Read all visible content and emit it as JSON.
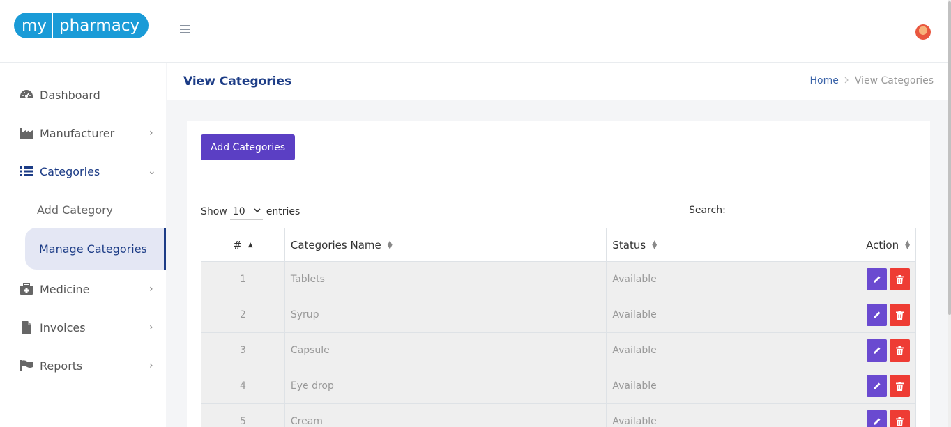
{
  "brand": {
    "my": "my",
    "pharmacy": "pharmacy"
  },
  "sidebar": {
    "items": [
      {
        "label": "Dashboard",
        "icon": "dashboard-icon",
        "chevron": ""
      },
      {
        "label": "Manufacturer",
        "icon": "factory-icon",
        "chevron": "›"
      },
      {
        "label": "Categories",
        "icon": "list-icon",
        "chevron": "⌄"
      },
      {
        "label": "Medicine",
        "icon": "medkit-icon",
        "chevron": "›"
      },
      {
        "label": "Invoices",
        "icon": "file-icon",
        "chevron": "›"
      },
      {
        "label": "Reports",
        "icon": "flag-icon",
        "chevron": "›"
      }
    ],
    "subitems": [
      {
        "label": "Add Category"
      },
      {
        "label": "Manage Categories"
      }
    ]
  },
  "page": {
    "title": "View Categories",
    "breadcrumb": {
      "home": "Home",
      "separator": ">",
      "current": "View Categories"
    }
  },
  "toolbar": {
    "add_label": "Add Categories"
  },
  "table_controls": {
    "show_label": "Show",
    "entries_value": "10",
    "entries_label": "entries",
    "search_label": "Search:",
    "search_value": ""
  },
  "table": {
    "columns": [
      "#",
      "Categories Name",
      "Status",
      "Action"
    ],
    "rows": [
      {
        "num": "1",
        "name": "Tablets",
        "status": "Available"
      },
      {
        "num": "2",
        "name": "Syrup",
        "status": "Available"
      },
      {
        "num": "3",
        "name": "Capsule",
        "status": "Available"
      },
      {
        "num": "4",
        "name": "Eye drop",
        "status": "Available"
      },
      {
        "num": "5",
        "name": "Cream",
        "status": "Available"
      }
    ]
  },
  "colors": {
    "brand": "#1a9bd7",
    "primary": "#5b3fc4",
    "danger": "#ee3c34",
    "nav_active": "#1c3c86"
  }
}
